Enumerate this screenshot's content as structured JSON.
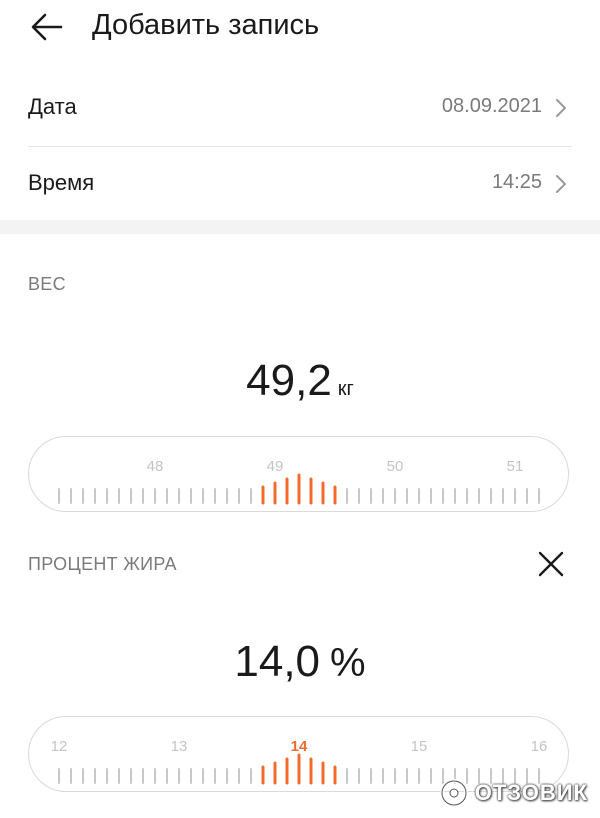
{
  "header": {
    "title": "Добавить запись",
    "back_icon": "arrow-left-icon"
  },
  "date": {
    "label": "Дата",
    "value": "08.09.2021"
  },
  "time": {
    "label": "Время",
    "value": "14:25"
  },
  "weight": {
    "label": "ВЕС",
    "value": "49,2",
    "unit": "кг",
    "ruler": {
      "labels": [
        "48",
        "49",
        "50",
        "51"
      ],
      "selected_value": 49.2
    }
  },
  "fat": {
    "label": "ПРОЦЕНТ ЖИРА",
    "value": "14,0",
    "unit": "%",
    "close_icon": "close-icon",
    "ruler": {
      "labels": [
        "12",
        "13",
        "14",
        "15",
        "16"
      ],
      "selected_value": 14.0,
      "selected_label": "14"
    }
  },
  "watermark": {
    "text": "ОТЗОВИК"
  },
  "colors": {
    "accent": "#f26a2e",
    "tick": "#c8c8c8",
    "label_gray": "#7a7a7a"
  }
}
